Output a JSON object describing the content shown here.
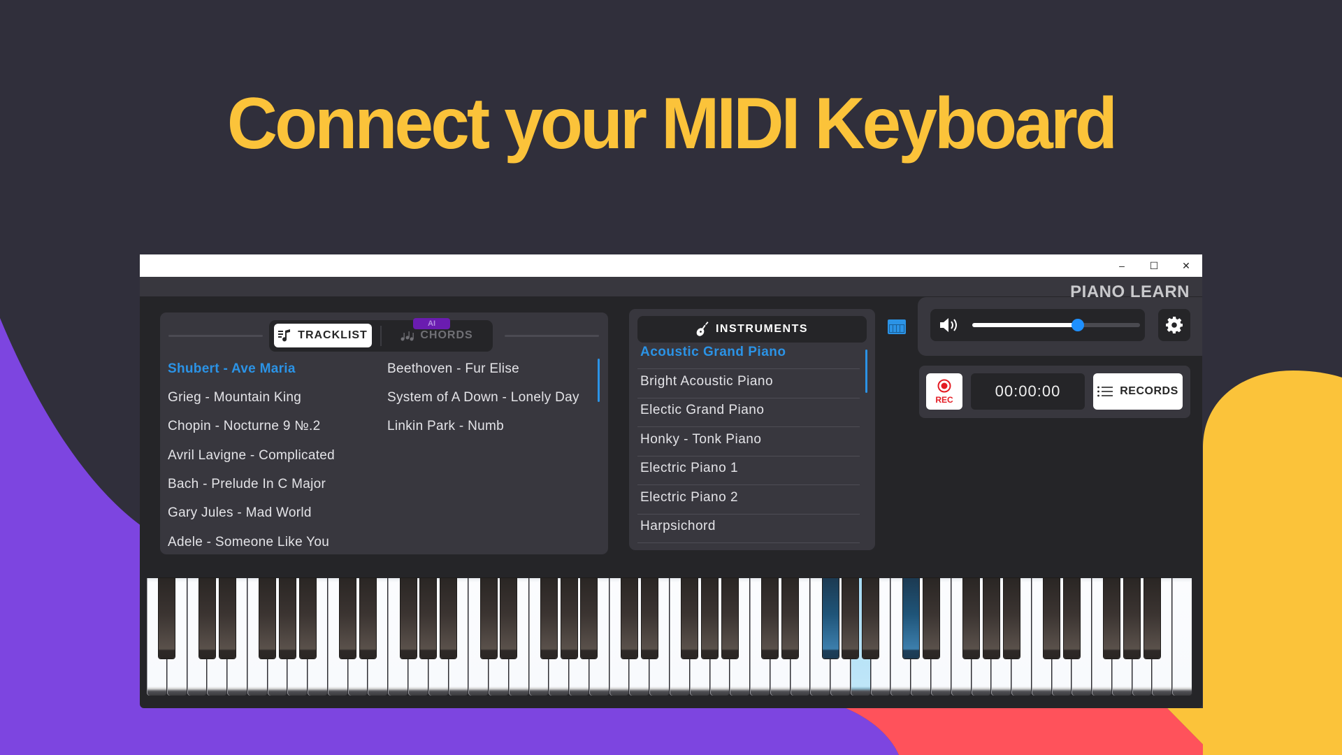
{
  "headline": "Connect your MIDI Keyboard",
  "colors": {
    "background": "#302f3b",
    "headline": "#fbc33a",
    "accent_blue": "#2b93e6",
    "purple_blob": "#7d45e0",
    "red_blob": "#ff525b",
    "yellow_blob": "#fbc33a",
    "rec_red": "#e41b23",
    "ai_badge": "#6a1cb0"
  },
  "window": {
    "controls": {
      "minimize": "–",
      "maximize": "☐",
      "close": "✕"
    },
    "brand": "PIANO LEARN"
  },
  "tracklist_panel": {
    "tabs": [
      {
        "label": "TRACKLIST",
        "icon": "music-list-icon",
        "active": true
      },
      {
        "label": "CHORDS",
        "icon": "music-notes-icon",
        "active": false,
        "badge": "AI"
      }
    ],
    "tracks_col1": [
      {
        "title": "Shubert - Ave Maria",
        "active": true
      },
      {
        "title": "Grieg - Mountain King"
      },
      {
        "title": "Chopin -  Nocturne 9 №.2"
      },
      {
        "title": "Avril Lavigne - Complicated"
      },
      {
        "title": "Bach - Prelude In C Major"
      },
      {
        "title": "Gary Jules - Mad World"
      },
      {
        "title": "Adele - Someone Like You"
      }
    ],
    "tracks_col2": [
      {
        "title": "Beethoven - Fur Elise"
      },
      {
        "title": "System of A Down - Lonely Day"
      },
      {
        "title": "Linkin Park - Numb"
      }
    ]
  },
  "instruments_panel": {
    "header": "INSTRUMENTS",
    "header_icon": "guitar-icon",
    "items": [
      {
        "name": "Acoustic Grand Piano",
        "active": true
      },
      {
        "name": "Bright Acoustic Piano"
      },
      {
        "name": "Electic Grand Piano"
      },
      {
        "name": "Honky - Tonk Piano"
      },
      {
        "name": "Electric Piano 1"
      },
      {
        "name": "Electric Piano 2"
      },
      {
        "name": "Harpsichord"
      }
    ],
    "side_icon": "piano-keys-icon"
  },
  "controls": {
    "volume_icon": "speaker-icon",
    "volume_percent": 63,
    "settings_icon": "gear-icon",
    "rec_label": "REC",
    "timer": "00:00:00",
    "records_label": "RECORDS",
    "records_icon": "list-icon"
  },
  "keyboard": {
    "lowest_note": "A0",
    "highest_note": "C8",
    "key_count": 88,
    "pressed_keys": [
      "F#5",
      "A5",
      "C#6"
    ]
  }
}
